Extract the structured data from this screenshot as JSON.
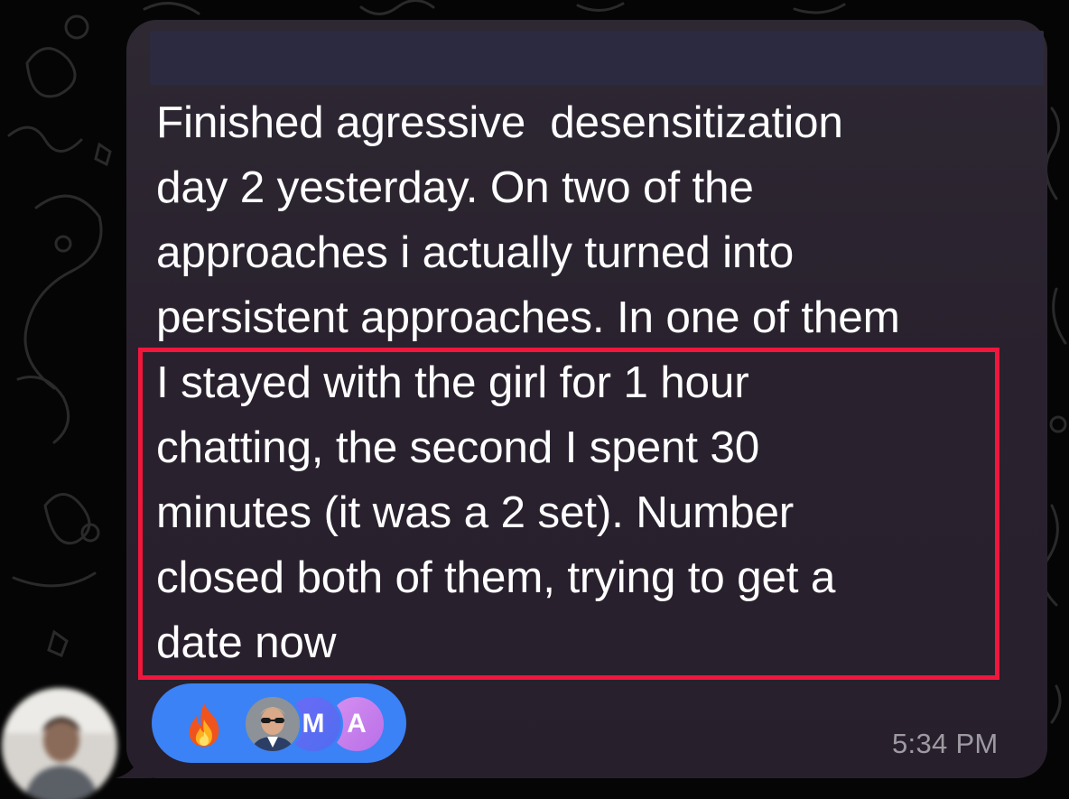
{
  "message": {
    "lines": [
      "Finished agressive  desensitization",
      "day 2 yesterday. On two of the",
      "approaches i actually turned into",
      "persistent approaches. In one of them",
      "I stayed with the girl for 1 hour",
      "chatting, the second I spent 30",
      "minutes (it was a 2 set). Number",
      "closed both of them, trying to get a",
      "date now"
    ],
    "timestamp": "5:34 PM"
  },
  "reactions": {
    "emoji": "fire-icon",
    "avatars": [
      {
        "kind": "photo",
        "initial": ""
      },
      {
        "kind": "initial",
        "initial": "M"
      },
      {
        "kind": "initial",
        "initial": "A"
      }
    ]
  },
  "colors": {
    "bubble": "#2b2430",
    "highlight_border": "#f0163c",
    "reaction_pill": "#3a82f6",
    "timestamp": "#9d9aa2",
    "text": "#ffffff"
  }
}
